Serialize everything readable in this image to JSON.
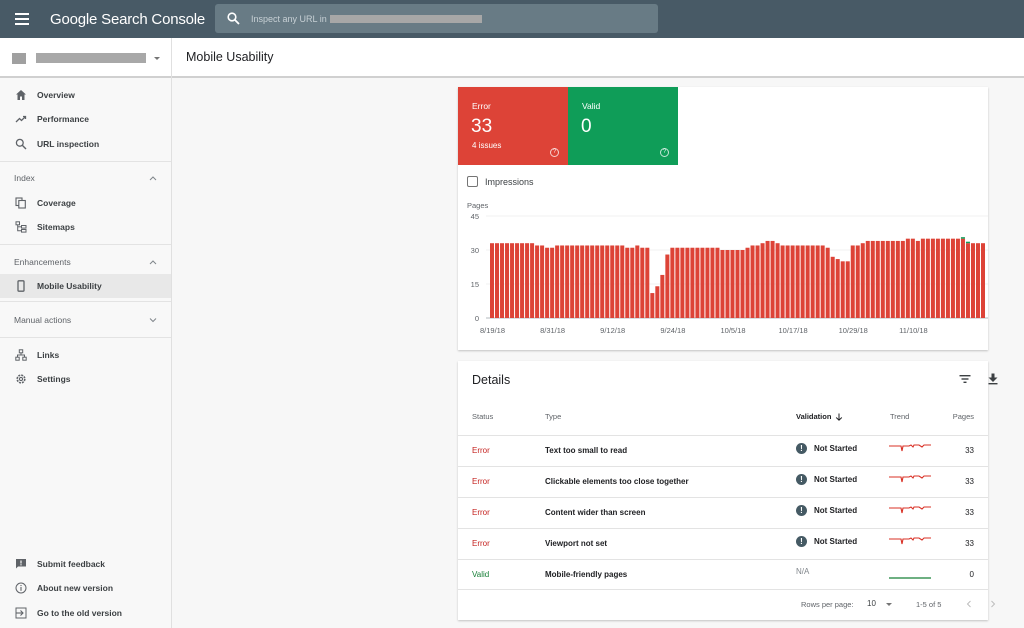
{
  "app": {
    "title": "Google Search Console",
    "menu_icon": "hamburger-menu-icon"
  },
  "search": {
    "placeholder": "Inspect any URL in",
    "icon": "search-icon"
  },
  "header": {
    "page_title": "Mobile Usability"
  },
  "sidebar": {
    "top_items": [
      {
        "label": "Overview",
        "icon": "home-icon"
      },
      {
        "label": "Performance",
        "icon": "trending-up-icon"
      },
      {
        "label": "URL inspection",
        "icon": "search-icon"
      }
    ],
    "sections": [
      {
        "label": "Index",
        "expanded": true,
        "items": [
          {
            "label": "Coverage",
            "icon": "file-copy-icon"
          },
          {
            "label": "Sitemaps",
            "icon": "sitemap-icon"
          }
        ]
      },
      {
        "label": "Enhancements",
        "expanded": true,
        "items": [
          {
            "label": "Mobile Usability",
            "icon": "smartphone-icon",
            "active": true
          }
        ]
      },
      {
        "label": "Manual actions",
        "expanded": false,
        "items": []
      }
    ],
    "other_items": [
      {
        "label": "Links",
        "icon": "links-icon"
      },
      {
        "label": "Settings",
        "icon": "gear-icon"
      }
    ],
    "bottom_items": [
      {
        "label": "Submit feedback",
        "icon": "feedback-icon"
      },
      {
        "label": "About new version",
        "icon": "info-icon"
      },
      {
        "label": "Go to the old version",
        "icon": "exit-to-app-icon"
      }
    ]
  },
  "summary": {
    "error": {
      "label": "Error",
      "value": "33",
      "sub": "4 issues",
      "color": "#dd4337"
    },
    "valid": {
      "label": "Valid",
      "value": "0",
      "color": "#0f9d58"
    },
    "impressions_label": "Impressions",
    "impressions_checked": false
  },
  "chart_data": {
    "type": "bar",
    "title": "",
    "ylabel": "Pages",
    "xlabel": "",
    "ylim": [
      0,
      45
    ],
    "yticks": [
      0,
      15,
      30,
      45
    ],
    "xtick_labels": [
      "8/19/18",
      "8/31/18",
      "9/12/18",
      "9/24/18",
      "10/5/18",
      "10/17/18",
      "10/29/18",
      "11/10/18"
    ],
    "start_date": "8/19/18",
    "grid": true,
    "series": [
      {
        "name": "Error",
        "color": "#dd4337",
        "values": [
          33,
          33,
          33,
          33,
          33,
          33,
          33,
          33,
          33,
          32,
          32,
          31,
          31,
          32,
          32,
          32,
          32,
          32,
          32,
          32,
          32,
          32,
          32,
          32,
          32,
          32,
          32,
          31,
          31,
          32,
          31,
          31,
          11,
          14,
          19,
          28,
          31,
          31,
          31,
          31,
          31,
          31,
          31,
          31,
          31,
          31,
          30,
          30,
          30,
          30,
          30,
          31,
          32,
          32,
          33,
          34,
          34,
          33,
          32,
          32,
          32,
          32,
          32,
          32,
          32,
          32,
          32,
          31,
          27,
          26,
          25,
          25,
          32,
          32,
          33,
          34,
          34,
          34,
          34,
          34,
          34,
          34,
          34,
          35,
          35,
          34,
          35,
          35,
          35,
          35,
          35,
          35,
          35,
          35,
          35,
          33,
          33,
          33,
          33
        ]
      },
      {
        "name": "Valid",
        "color": "#0f9d58",
        "values": [
          0,
          0,
          0,
          0,
          0,
          0,
          0,
          0,
          0,
          0,
          0,
          0,
          0,
          0,
          0,
          0,
          0,
          0,
          0,
          0,
          0,
          0,
          0,
          0,
          0,
          0,
          0,
          0,
          0,
          0,
          0,
          0,
          0,
          0,
          0,
          0,
          0,
          0,
          0,
          0,
          0,
          0,
          0,
          0,
          0,
          0,
          0,
          0,
          0,
          0,
          0,
          0,
          0,
          0,
          0,
          0,
          0,
          0,
          0,
          0,
          0,
          0,
          0,
          0,
          0,
          0,
          0,
          0,
          0,
          0,
          0,
          0,
          0,
          0,
          0,
          0,
          0,
          0,
          0,
          0,
          0,
          0,
          0,
          0,
          0,
          0,
          0,
          0,
          0,
          0,
          0,
          0,
          0,
          0,
          1,
          1,
          0,
          0,
          0
        ]
      }
    ]
  },
  "details": {
    "title": "Details",
    "filter_icon": "filter-list-icon",
    "download_icon": "download-icon",
    "columns": {
      "status": "Status",
      "type": "Type",
      "validation": "Validation",
      "trend": "Trend",
      "pages": "Pages"
    },
    "rows": [
      {
        "status": "Error",
        "type": "Text too small to read",
        "validation": "Not Started",
        "pages": "33",
        "trend": "error"
      },
      {
        "status": "Error",
        "type": "Clickable elements too close together",
        "validation": "Not Started",
        "pages": "33",
        "trend": "error"
      },
      {
        "status": "Error",
        "type": "Content wider than screen",
        "validation": "Not Started",
        "pages": "33",
        "trend": "error"
      },
      {
        "status": "Error",
        "type": "Viewport not set",
        "validation": "Not Started",
        "pages": "33",
        "trend": "error"
      },
      {
        "status": "Valid",
        "type": "Mobile-friendly pages",
        "validation": "N/A",
        "pages": "0",
        "trend": "valid"
      }
    ],
    "pagination": {
      "rows_per_page_label": "Rows per page:",
      "rows_per_page": "10",
      "range": "1-5 of 5"
    }
  }
}
